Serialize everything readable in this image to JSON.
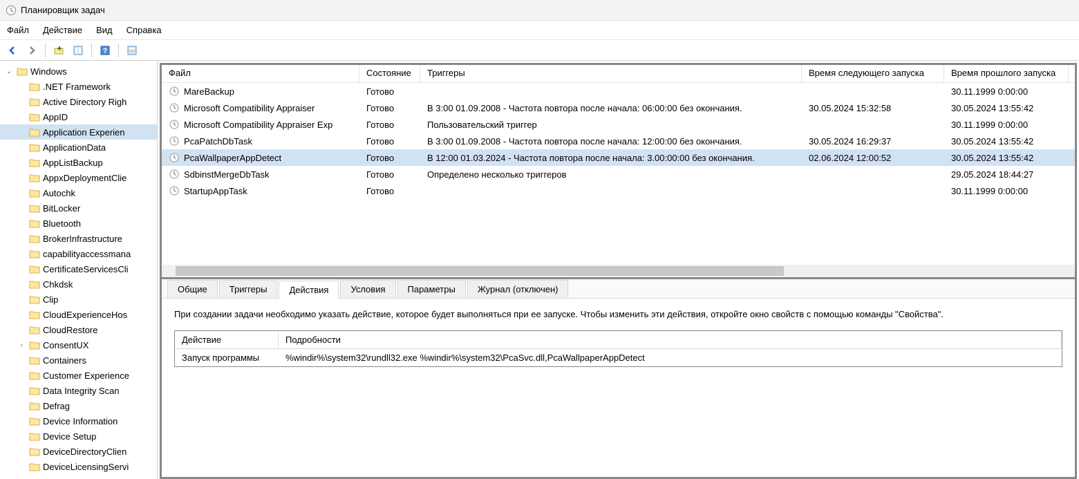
{
  "window_title": "Планировщик задач",
  "menus": [
    "Файл",
    "Действие",
    "Вид",
    "Справка"
  ],
  "tree": {
    "root": "Windows",
    "selected": "Application Experience",
    "children": [
      ".NET Framework",
      "Active Directory Righ",
      "AppID",
      "Application Experien",
      "ApplicationData",
      "AppListBackup",
      "AppxDeploymentClie",
      "Autochk",
      "BitLocker",
      "Bluetooth",
      "BrokerInfrastructure",
      "capabilityaccessmana",
      "CertificateServicesCli",
      "Chkdsk",
      "Clip",
      "CloudExperienceHos",
      "CloudRestore",
      "ConsentUX",
      "Containers",
      "Customer Experience",
      "Data Integrity Scan",
      "Defrag",
      "Device Information",
      "Device Setup",
      "DeviceDirectoryClien",
      "DeviceLicensingServi"
    ],
    "expandable": [
      "ConsentUX"
    ]
  },
  "task_columns": [
    "Файл",
    "Состояние",
    "Триггеры",
    "Время следующего запуска",
    "Время прошлого запуска"
  ],
  "tasks": [
    {
      "name": "MareBackup",
      "state": "Готово",
      "trigger": "",
      "next": "",
      "last": "30.11.1999 0:00:00"
    },
    {
      "name": "Microsoft Compatibility Appraiser",
      "state": "Готово",
      "trigger": "В 3:00 01.09.2008 - Частота повтора после начала: 06:00:00 без окончания.",
      "next": "30.05.2024 15:32:58",
      "last": "30.05.2024 13:55:42"
    },
    {
      "name": "Microsoft Compatibility Appraiser Exp",
      "state": "Готово",
      "trigger": "Пользовательский триггер",
      "next": "",
      "last": "30.11.1999 0:00:00"
    },
    {
      "name": "PcaPatchDbTask",
      "state": "Готово",
      "trigger": "В 3:00 01.09.2008 - Частота повтора после начала: 12:00:00 без окончания.",
      "next": "30.05.2024 16:29:37",
      "last": "30.05.2024 13:55:42"
    },
    {
      "name": "PcaWallpaperAppDetect",
      "state": "Готово",
      "trigger": "В 12:00 01.03.2024 - Частота повтора после начала: 3.00:00:00 без окончания.",
      "next": "02.06.2024 12:00:52",
      "last": "30.05.2024 13:55:42",
      "selected": true
    },
    {
      "name": "SdbinstMergeDbTask",
      "state": "Готово",
      "trigger": "Определено несколько триггеров",
      "next": "",
      "last": "29.05.2024 18:44:27"
    },
    {
      "name": "StartupAppTask",
      "state": "Готово",
      "trigger": "",
      "next": "",
      "last": "30.11.1999 0:00:00"
    }
  ],
  "tabs": [
    "Общие",
    "Триггеры",
    "Действия",
    "Условия",
    "Параметры",
    "Журнал (отключен)"
  ],
  "active_tab": 2,
  "tab_content": {
    "description": "При создании задачи необходимо указать действие, которое будет выполняться при ее запуске.  Чтобы изменить эти действия, откройте окно свойств с помощью команды \"Свойства\".",
    "action_headers": [
      "Действие",
      "Подробности"
    ],
    "actions": [
      {
        "action": "Запуск программы",
        "details": "%windir%\\system32\\rundll32.exe %windir%\\system32\\PcaSvc.dll,PcaWallpaperAppDetect"
      }
    ]
  }
}
